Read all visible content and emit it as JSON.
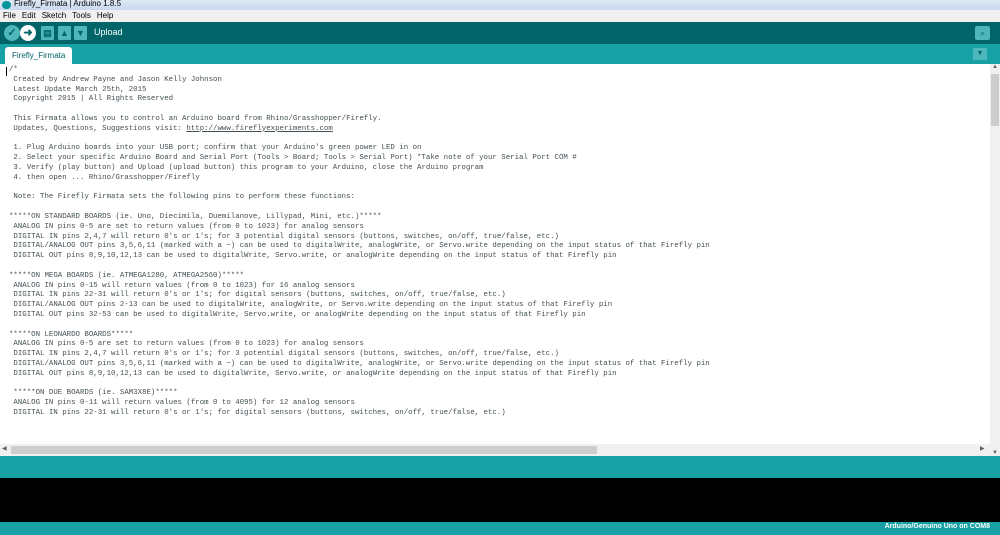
{
  "window": {
    "title": "Firefly_Firmata | Arduino 1.8.5"
  },
  "menu": [
    "File",
    "Edit",
    "Sketch",
    "Tools",
    "Help"
  ],
  "toolbar": {
    "hover_label": "Upload"
  },
  "tabs": [
    {
      "label": "Firefly_Firmata"
    }
  ],
  "editor": {
    "lines": [
      "/*",
      " Created by Andrew Payne and Jason Kelly Johnson",
      " Latest Update March 25th, 2015",
      " Copyright 2015 | All Rights Reserved",
      "",
      " This Firmata allows you to control an Arduino board from Rhino/Grasshopper/Firefly.",
      " Updates, Questions, Suggestions visit: http://www.fireflyexperiments.com",
      "",
      " 1. Plug Arduino boards into your USB port; confirm that your Arduino's green power LED in on",
      " 2. Select your specific Arduino Board and Serial Port (Tools > Board; Tools > Serial Port) *Take note of your Serial Port COM #",
      " 3. Verify (play button) and Upload (upload button) this program to your Arduino, close the Arduino program",
      " 4. then open ... Rhino/Grasshopper/Firefly",
      "",
      " Note: The Firefly Firmata sets the following pins to perform these functions:",
      "",
      "*****ON STANDARD BOARDS (ie. Uno, Diecimila, Duemilanove, Lillypad, Mini, etc.)*****",
      " ANALOG IN pins 0-5 are set to return values (from 0 to 1023) for analog sensors",
      " DIGITAL IN pins 2,4,7 will return 0's or 1's; for 3 potential digital sensors (buttons, switches, on/off, true/false, etc.)",
      " DIGITAL/ANALOG OUT pins 3,5,6,11 (marked with a ~) can be used to digitalWrite, analogWrite, or Servo.write depending on the input status of that Firefly pin",
      " DIGITAL OUT pins 8,9,10,12,13 can be used to digitalWrite, Servo.write, or analogWrite depending on the input status of that Firefly pin",
      "",
      "*****ON MEGA BOARDS (ie. ATMEGA1280, ATMEGA2560)*****",
      " ANALOG IN pins 0-15 will return values (from 0 to 1023) for 16 analog sensors",
      " DIGITAL IN pins 22-31 will return 0's or 1's; for digital sensors (buttons, switches, on/off, true/false, etc.)",
      " DIGITAL/ANALOG OUT pins 2-13 can be used to digitalWrite, analogWrite, or Servo.write depending on the input status of that Firefly pin",
      " DIGITAL OUT pins 32-53 can be used to digitalWrite, Servo.write, or analogWrite depending on the input status of that Firefly pin",
      "",
      "*****ON LEONARDO BOARDS*****",
      " ANALOG IN pins 0-5 are set to return values (from 0 to 1023) for analog sensors",
      " DIGITAL IN pins 2,4,7 will return 0's or 1's; for 3 potential digital sensors (buttons, switches, on/off, true/false, etc.)",
      " DIGITAL/ANALOG OUT pins 3,5,6,11 (marked with a ~) can be used to digitalWrite, analogWrite, or Servo.write depending on the input status of that Firefly pin",
      " DIGITAL OUT pins 8,9,10,12,13 can be used to digitalWrite, Servo.write, or analogWrite depending on the input status of that Firefly pin",
      "",
      " *****ON DUE BOARDS (ie. SAM3X8E)*****",
      " ANALOG IN pins 0-11 will return values (from 0 to 4095) for 12 analog sensors",
      " DIGITAL IN pins 22-31 will return 0's or 1's; for digital sensors (buttons, switches, on/off, true/false, etc.)"
    ]
  },
  "status": {
    "board": "Arduino/Genuino Uno on COM8"
  },
  "colors": {
    "toolbar": "#006468",
    "accent": "#17a1a5",
    "button": "#4db7bb"
  }
}
